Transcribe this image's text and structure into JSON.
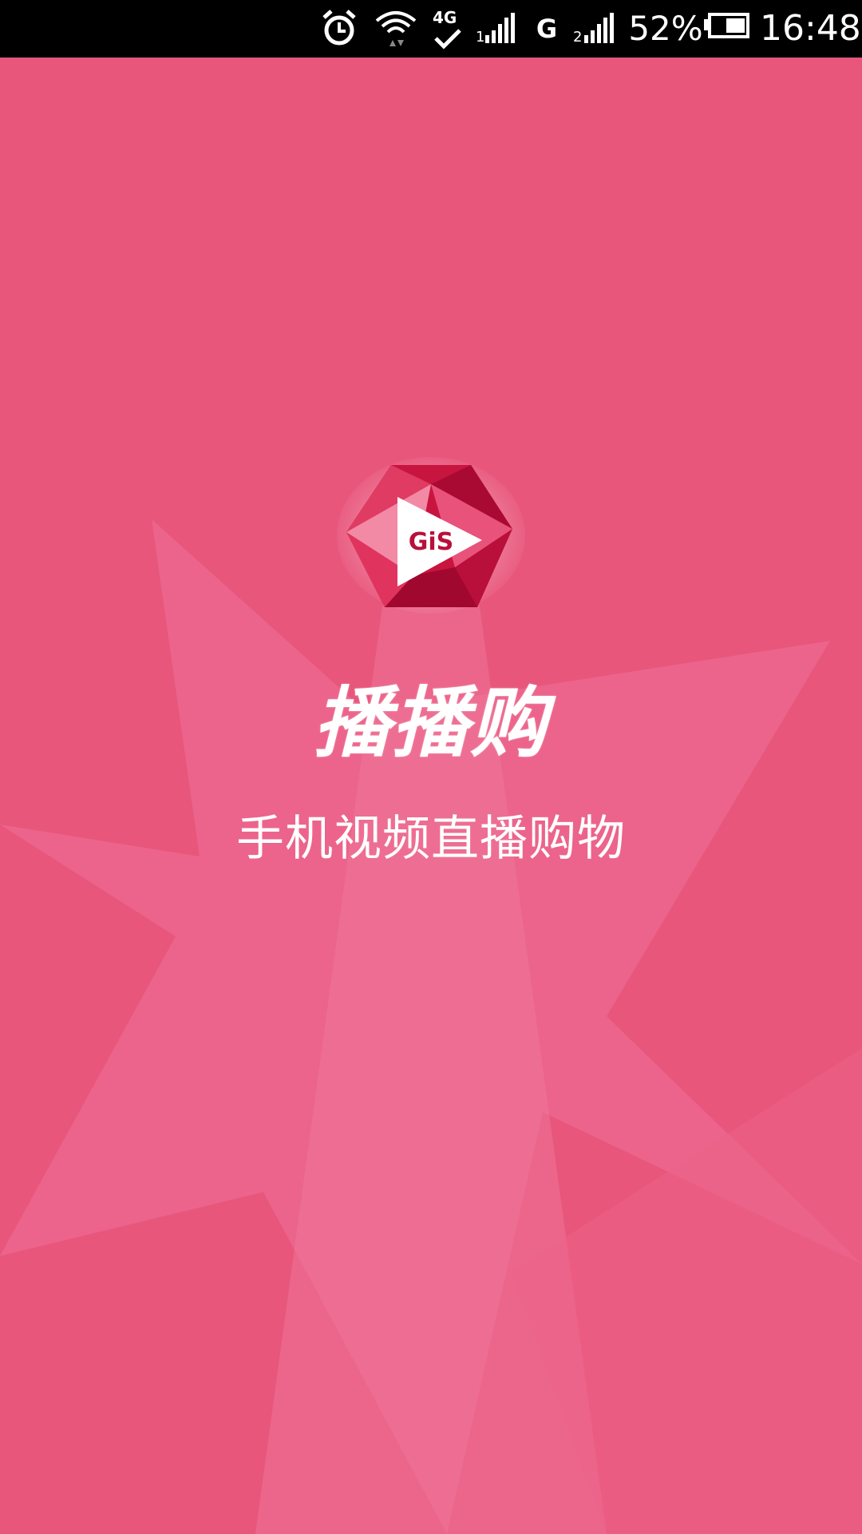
{
  "status_bar": {
    "battery_percent": "52%",
    "time": "16:48",
    "network_4g": "4G",
    "network_g": "G",
    "icons": [
      "alarm-icon",
      "wifi-icon",
      "4g-icon",
      "signal-sim1-icon",
      "g-network-icon",
      "signal-sim2-icon",
      "battery-icon"
    ]
  },
  "splash": {
    "logo_text": "GiS",
    "app_name": "播播购",
    "slogan": "手机视频直播购物"
  },
  "colors": {
    "background": "#e8567c",
    "star": "#ee7196",
    "logo_dark": "#b8103a",
    "logo_mid": "#e0345e",
    "logo_light": "#f28aa5"
  }
}
